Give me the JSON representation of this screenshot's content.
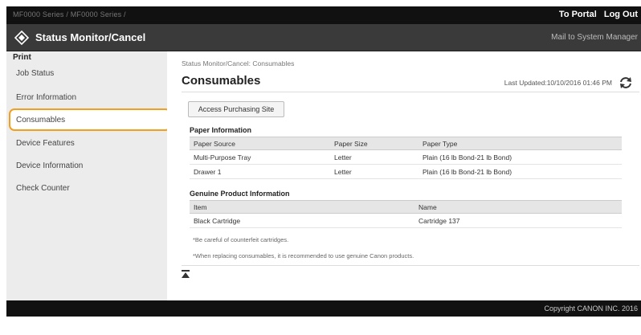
{
  "header": {
    "model": "MF0000 Series / MF0000 Series /",
    "portal_label": "To Portal",
    "logout_label": "Log Out",
    "app_title": "Status Monitor/Cancel",
    "mail_label": "Mail to System Manager"
  },
  "sidebar": {
    "section_label": "Print",
    "items": [
      {
        "label": "Job Status"
      },
      {
        "label": "Error Information"
      },
      {
        "label": "Consumables"
      },
      {
        "label": "Device Features"
      },
      {
        "label": "Device Information"
      },
      {
        "label": "Check Counter"
      }
    ]
  },
  "main": {
    "breadcrumb": "Status Monitor/Cancel: Consumables",
    "title": "Consumables",
    "last_updated": "Last Updated:10/10/2016 01:46 PM",
    "purchase_button": "Access Purchasing Site",
    "paper": {
      "heading": "Paper Information",
      "columns": [
        "Paper Source",
        "Paper Size",
        "Paper Type"
      ],
      "rows": [
        [
          "Multi-Purpose Tray",
          "Letter",
          "Plain (16 lb Bond-21 lb Bond)"
        ],
        [
          "Drawer 1",
          "Letter",
          "Plain (16 lb Bond-21 lb Bond)"
        ]
      ]
    },
    "genuine": {
      "heading": "Genuine Product Information",
      "columns": [
        "Item",
        "Name"
      ],
      "rows": [
        [
          "Black Cartridge",
          "Cartridge 137"
        ]
      ]
    },
    "note1": "*Be careful of counterfeit cartridges.",
    "note2": "*When replacing consumables, it is recommended to use genuine Canon products."
  },
  "footer": {
    "copyright": "Copyright CANON INC. 2016"
  },
  "colors": {
    "highlight": "#f0a020",
    "title_bar": "#3a3a3a",
    "top_bar": "#111111",
    "sidebar": "#ececec"
  }
}
